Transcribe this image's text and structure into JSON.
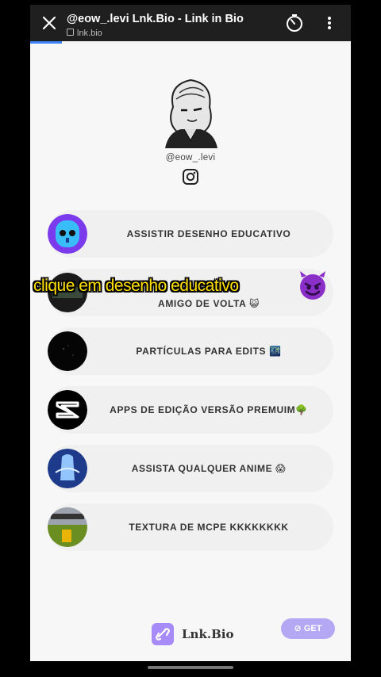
{
  "browser": {
    "title": "@eow_.levi Lnk.Bio - Link in Bio",
    "url": "lnk.bio"
  },
  "profile": {
    "handle": "@eow_.levi"
  },
  "links": [
    {
      "label": "ASSISTIR DESENHO EDUCATIVO",
      "thumb": "blue-robot"
    },
    {
      "label": "AMIGO DE VOLTA 😺",
      "thumb": "game-screenshot"
    },
    {
      "label": "PARTÍCULAS PARA EDITS 🌃",
      "thumb": "particles"
    },
    {
      "label": "APPS DE EDIÇÃO VERSÃO PREMUIM🌳",
      "thumb": "capcut-logo"
    },
    {
      "label": "ASSISTA QUALQUER ANIME 😱",
      "thumb": "anime-character"
    },
    {
      "label": "TEXTURA DE MCPE KKKKKKKK",
      "thumb": "minecraft"
    }
  ],
  "overlay": {
    "caption": "clique em desenho educativo"
  },
  "footer": {
    "brand": "Lnk.Bio",
    "get_label": "GET"
  },
  "colors": {
    "accent": "#3b82f6",
    "brand": "#a78bfa",
    "caption": "#ffe000"
  }
}
